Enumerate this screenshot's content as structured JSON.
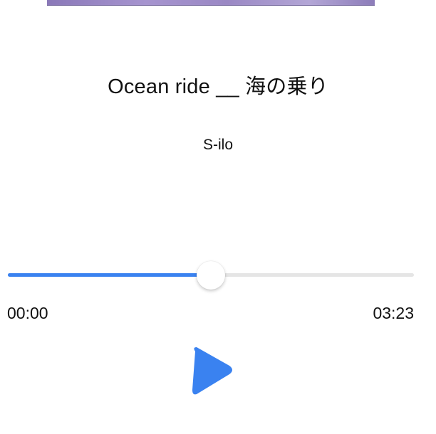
{
  "track": {
    "title": "Ocean ride __ 海の乗り",
    "artist": "S-ilo"
  },
  "player": {
    "elapsed": "00:00",
    "duration": "03:23",
    "progress_fraction": 0.5,
    "state": "paused",
    "play_icon": "play-icon"
  },
  "colors": {
    "accent": "#3a82f0",
    "track_background": "#e5e5e5",
    "album_art_tint": "#9a88c4"
  }
}
